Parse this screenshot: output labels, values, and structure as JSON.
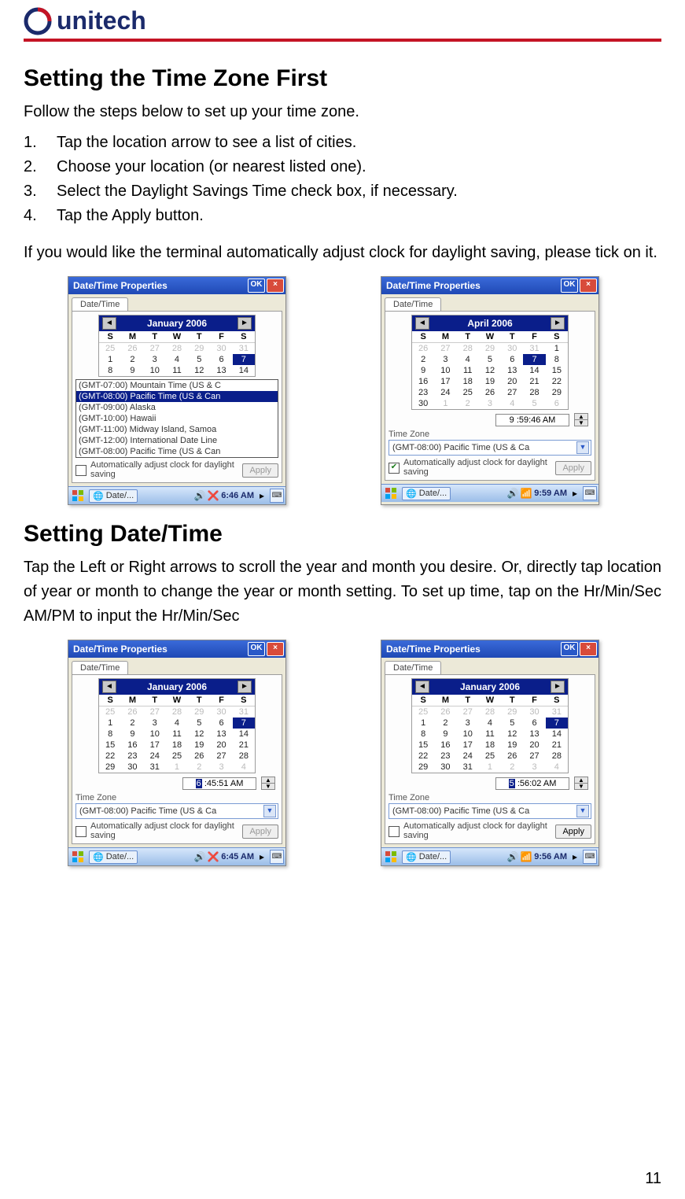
{
  "brand": {
    "name": "unitech"
  },
  "section1": {
    "heading": "Setting the Time Zone First",
    "lead": "Follow the steps below to set up your time zone.",
    "steps": [
      "Tap the location arrow to see a list of cities.",
      "Choose your location (or nearest listed one).",
      "Select the Daylight Savings Time check box, if necessary.",
      "Tap the Apply button."
    ],
    "note": "If you would like the terminal automatically adjust clock for daylight saving, please tick on it."
  },
  "section2": {
    "heading": "Setting Date/Time",
    "body": "Tap the Left or Right arrows to scroll the year and month you desire. Or, directly tap location of year or month to change the year or month setting. To set up time, tap on the Hr/Min/Sec AM/PM to input the Hr/Min/Sec"
  },
  "page_number": "11",
  "common": {
    "window_title": "Date/Time Properties",
    "ok": "OK",
    "tab": "Date/Time",
    "dow": [
      "S",
      "M",
      "T",
      "W",
      "T",
      "F",
      "S"
    ],
    "tz_label": "Time Zone",
    "tz_value": "(GMT-08:00) Pacific Time (US & Ca",
    "dst": "Automatically adjust clock for daylight saving",
    "apply": "Apply",
    "task_label": "Date/..."
  },
  "tz_options": [
    "(GMT-07:00) Mountain Time (US & C",
    "(GMT-08:00) Pacific Time (US & Can",
    "(GMT-09:00) Alaska",
    "(GMT-10:00) Hawaii",
    "(GMT-11:00) Midway Island, Samoa",
    "(GMT-12:00) International Date Line",
    "(GMT-08:00) Pacific Time (US & Can"
  ],
  "shot1": {
    "month": "January 2006",
    "rows": [
      [
        "25",
        "26",
        "27",
        "28",
        "29",
        "30",
        "31"
      ],
      [
        "1",
        "2",
        "3",
        "4",
        "5",
        "6",
        "7"
      ],
      [
        "8",
        "9",
        "10",
        "11",
        "12",
        "13",
        "14"
      ]
    ],
    "other_row": 0,
    "sel": [
      1,
      6
    ],
    "clock": "6:46 AM"
  },
  "shot2": {
    "month": "April 2006",
    "rows": [
      [
        "26",
        "27",
        "28",
        "29",
        "30",
        "31",
        "1"
      ],
      [
        "2",
        "3",
        "4",
        "5",
        "6",
        "7",
        "8"
      ],
      [
        "9",
        "10",
        "11",
        "12",
        "13",
        "14",
        "15"
      ],
      [
        "16",
        "17",
        "18",
        "19",
        "20",
        "21",
        "22"
      ],
      [
        "23",
        "24",
        "25",
        "26",
        "27",
        "28",
        "29"
      ],
      [
        "30",
        "1",
        "2",
        "3",
        "4",
        "5",
        "6"
      ]
    ],
    "other_cells": [
      [
        0,
        0
      ],
      [
        0,
        1
      ],
      [
        0,
        2
      ],
      [
        0,
        3
      ],
      [
        0,
        4
      ],
      [
        0,
        5
      ],
      [
        5,
        1
      ],
      [
        5,
        2
      ],
      [
        5,
        3
      ],
      [
        5,
        4
      ],
      [
        5,
        5
      ],
      [
        5,
        6
      ]
    ],
    "sel": [
      1,
      5
    ],
    "time": "9 :59:46 AM",
    "clock": "9:59 AM"
  },
  "shot3": {
    "month": "January 2006",
    "rows": [
      [
        "25",
        "26",
        "27",
        "28",
        "29",
        "30",
        "31"
      ],
      [
        "1",
        "2",
        "3",
        "4",
        "5",
        "6",
        "7"
      ],
      [
        "8",
        "9",
        "10",
        "11",
        "12",
        "13",
        "14"
      ],
      [
        "15",
        "16",
        "17",
        "18",
        "19",
        "20",
        "21"
      ],
      [
        "22",
        "23",
        "24",
        "25",
        "26",
        "27",
        "28"
      ],
      [
        "29",
        "30",
        "31",
        "1",
        "2",
        "3",
        "4"
      ]
    ],
    "other_cells": [
      [
        0,
        0
      ],
      [
        0,
        1
      ],
      [
        0,
        2
      ],
      [
        0,
        3
      ],
      [
        0,
        4
      ],
      [
        0,
        5
      ],
      [
        0,
        6
      ],
      [
        5,
        3
      ],
      [
        5,
        4
      ],
      [
        5,
        5
      ],
      [
        5,
        6
      ]
    ],
    "sel": [
      1,
      6
    ],
    "time_prefix": "6",
    "time_rest": " :45:51 AM",
    "clock": "6:45 AM"
  },
  "shot4": {
    "month": "January 2006",
    "rows": [
      [
        "25",
        "26",
        "27",
        "28",
        "29",
        "30",
        "31"
      ],
      [
        "1",
        "2",
        "3",
        "4",
        "5",
        "6",
        "7"
      ],
      [
        "8",
        "9",
        "10",
        "11",
        "12",
        "13",
        "14"
      ],
      [
        "15",
        "16",
        "17",
        "18",
        "19",
        "20",
        "21"
      ],
      [
        "22",
        "23",
        "24",
        "25",
        "26",
        "27",
        "28"
      ],
      [
        "29",
        "30",
        "31",
        "1",
        "2",
        "3",
        "4"
      ]
    ],
    "other_cells": [
      [
        0,
        0
      ],
      [
        0,
        1
      ],
      [
        0,
        2
      ],
      [
        0,
        3
      ],
      [
        0,
        4
      ],
      [
        0,
        5
      ],
      [
        0,
        6
      ],
      [
        5,
        3
      ],
      [
        5,
        4
      ],
      [
        5,
        5
      ],
      [
        5,
        6
      ]
    ],
    "sel": [
      1,
      6
    ],
    "time_prefix": "5",
    "time_rest": " :56:02 AM",
    "clock": "9:56 AM"
  }
}
